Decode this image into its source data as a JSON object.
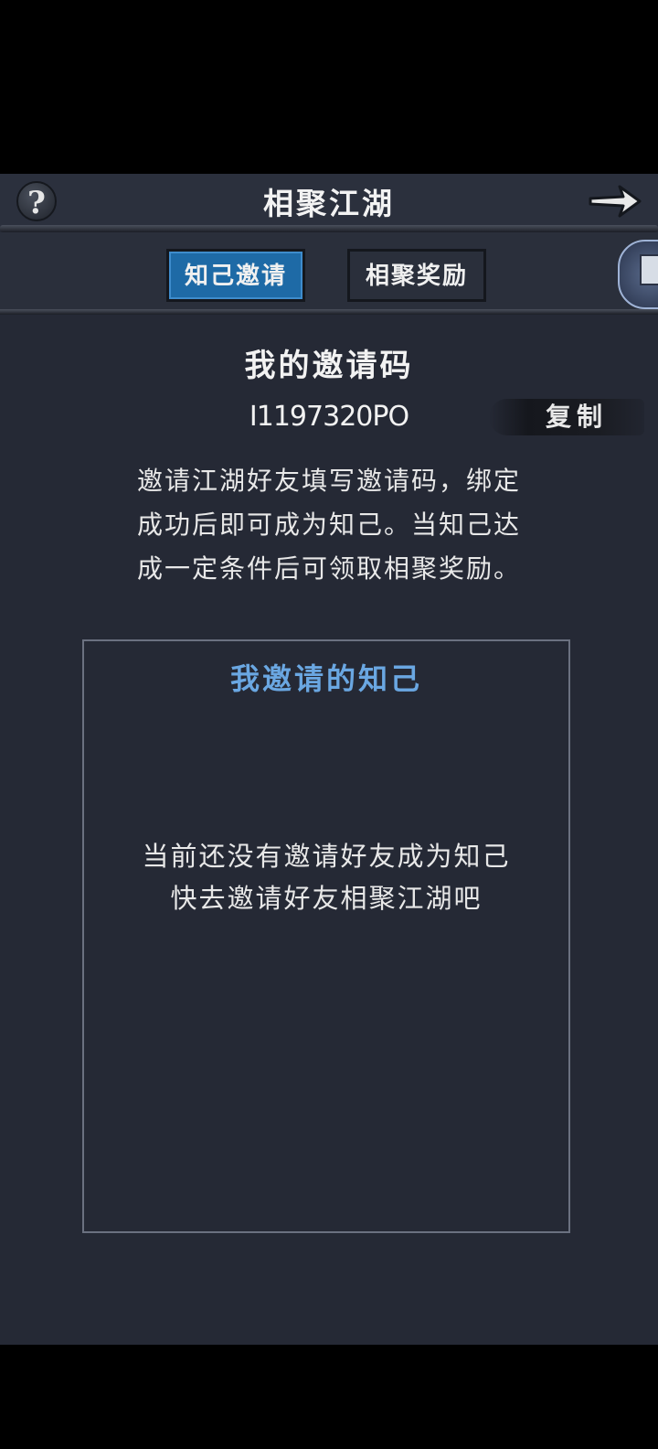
{
  "header": {
    "help_icon": "question-mark-icon",
    "help_label": "?",
    "title": "相聚江湖",
    "forward_icon": "arrow-right-icon"
  },
  "tabs": [
    {
      "label": "知己邀请",
      "active": true
    },
    {
      "label": "相聚奖励",
      "active": false
    }
  ],
  "side_icon": "book-icon",
  "invite": {
    "title": "我的邀请码",
    "code": "I1197320PO",
    "copy_label": "复制",
    "description_lines": [
      "邀请江湖好友填写邀请码，绑定",
      "成功后即可成为知己。当知己达",
      "成一定条件后可领取相聚奖励。"
    ]
  },
  "friends_panel": {
    "title": "我邀请的知己",
    "empty_lines": [
      "当前还没有邀请好友成为知己",
      "快去邀请好友相聚江湖吧"
    ]
  },
  "colors": {
    "background": "#252935",
    "active_tab": "#1e6aa6",
    "panel_title": "#6aa7e2",
    "text": "#f2f2f2"
  }
}
